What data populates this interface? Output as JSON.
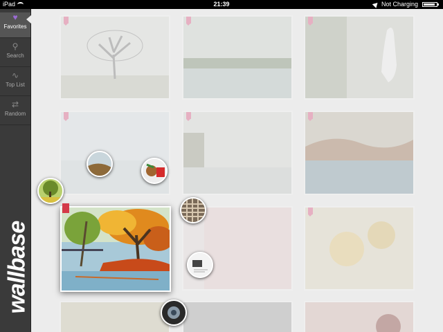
{
  "status_bar": {
    "device": "iPad",
    "time": "21:39",
    "charging": "Not Charging"
  },
  "sidebar": {
    "items": [
      {
        "label": "Favorites",
        "icon": "heart-icon"
      },
      {
        "label": "Search",
        "icon": "search-icon"
      },
      {
        "label": "Top List",
        "icon": "pulse-icon"
      },
      {
        "label": "Random",
        "icon": "shuffle-icon"
      }
    ],
    "brand": "wallbase"
  },
  "colors": {
    "accent": "#9b6bd4",
    "bookmark": "#d43a4a",
    "sidebar": "#3a3a3a"
  }
}
